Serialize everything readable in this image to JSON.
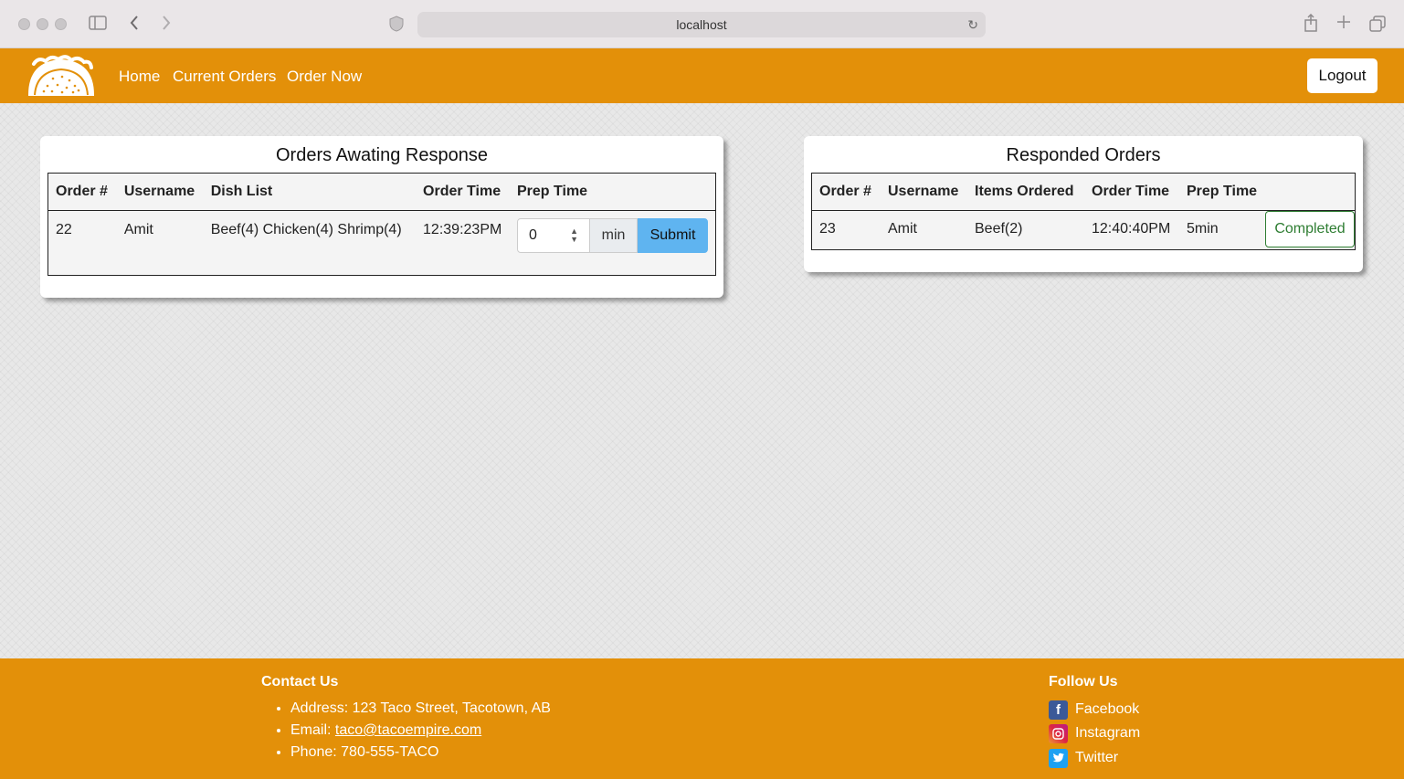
{
  "browser": {
    "url": "localhost"
  },
  "navbar": {
    "links": [
      "Home",
      "Current Orders",
      "Order Now"
    ],
    "logout_label": "Logout"
  },
  "awaiting": {
    "title": "Orders Awating Response",
    "headers": [
      "Order #",
      "Username",
      "Dish List",
      "Order Time",
      "Prep Time"
    ],
    "rows": [
      {
        "order": "22",
        "username": "Amit",
        "dishes": "Beef(4) Chicken(4) Shrimp(4)",
        "time": "12:39:23PM",
        "prep_value": "0",
        "prep_unit": "min",
        "submit_label": "Submit"
      }
    ]
  },
  "responded": {
    "title": "Responded Orders",
    "headers": [
      "Order #",
      "Username",
      "Items Ordered",
      "Order Time",
      "Prep Time"
    ],
    "rows": [
      {
        "order": "23",
        "username": "Amit",
        "items": "Beef(2)",
        "time": "12:40:40PM",
        "prep": "5min",
        "status_label": "Completed"
      }
    ]
  },
  "footer": {
    "contact_title": "Contact Us",
    "address": "Address: 123 Taco Street, Tacotown, AB",
    "email_label": "Email: ",
    "email": "taco@tacoempire.com",
    "phone": "Phone: 780-555-TACO",
    "follow_title": "Follow Us",
    "social": [
      "Facebook",
      "Instagram",
      "Twitter"
    ]
  },
  "colors": {
    "brand": "#e39009",
    "submit": "#5fb4f0",
    "completed": "#2e7d32"
  }
}
